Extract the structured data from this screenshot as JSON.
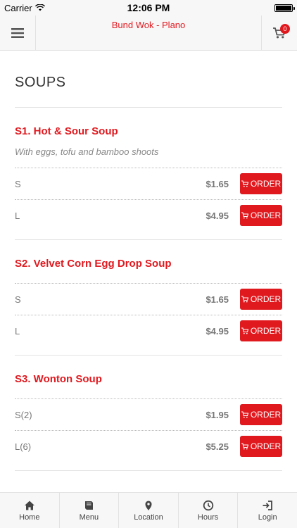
{
  "status": {
    "carrier": "Carrier",
    "time": "12:06 PM"
  },
  "header": {
    "title": "Bund Wok - Plano",
    "cart_count": "0"
  },
  "section": {
    "title": "SOUPS"
  },
  "items": [
    {
      "name": "S1. Hot & Sour Soup",
      "description": "With eggs, tofu and bamboo shoots",
      "options": [
        {
          "size": "S",
          "price": "$1.65",
          "order_label": "ORDER"
        },
        {
          "size": "L",
          "price": "$4.95",
          "order_label": "ORDER"
        }
      ]
    },
    {
      "name": "S2. Velvet Corn Egg Drop Soup",
      "options": [
        {
          "size": "S",
          "price": "$1.65",
          "order_label": "ORDER"
        },
        {
          "size": "L",
          "price": "$4.95",
          "order_label": "ORDER"
        }
      ]
    },
    {
      "name": "S3. Wonton Soup",
      "options": [
        {
          "size": "S(2)",
          "price": "$1.95",
          "order_label": "ORDER"
        },
        {
          "size": "L(6)",
          "price": "$5.25",
          "order_label": "ORDER"
        }
      ]
    }
  ],
  "tabs": [
    {
      "label": "Home",
      "icon": "home-icon"
    },
    {
      "label": "Menu",
      "icon": "book-icon"
    },
    {
      "label": "Location",
      "icon": "map-pin-icon"
    },
    {
      "label": "Hours",
      "icon": "clock-icon"
    },
    {
      "label": "Login",
      "icon": "login-icon"
    }
  ],
  "colors": {
    "accent": "#e0191f",
    "bar_background": "#f7f7f7"
  }
}
